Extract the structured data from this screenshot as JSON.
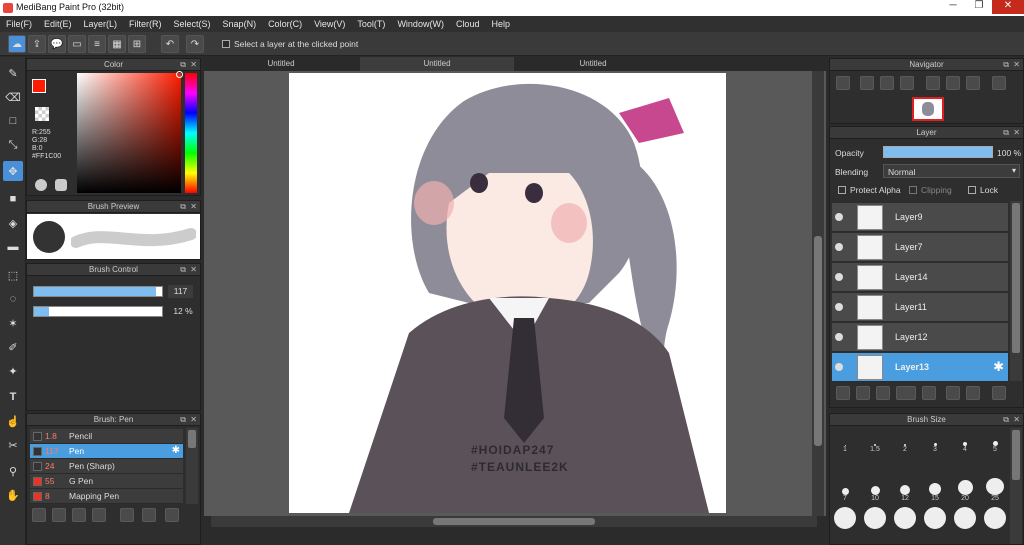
{
  "app": {
    "title": "MediBang Paint Pro (32bit)"
  },
  "menu": [
    "File(F)",
    "Edit(E)",
    "Layer(L)",
    "Filter(R)",
    "Select(S)",
    "Snap(N)",
    "Color(C)",
    "View(V)",
    "Tool(T)",
    "Window(W)",
    "Cloud",
    "Help"
  ],
  "toolbar": {
    "select_layer_label": "Select a layer at the clicked point"
  },
  "tabs": [
    "Untitled",
    "Untitled",
    "Untitled"
  ],
  "color_panel": {
    "title": "Color",
    "r": "R:255",
    "g": "G:28",
    "b": "B:0",
    "hex": "#FF1C00",
    "primary": "#FF1C00"
  },
  "brush_preview": {
    "title": "Brush Preview"
  },
  "brush_control": {
    "title": "Brush Control",
    "size": "117",
    "opacity": "12 %",
    "size_fill": 0.95,
    "opacity_fill": 0.12
  },
  "brush_panel": {
    "title": "Brush: Pen",
    "items": [
      {
        "size": "1.8",
        "name": "Pencil",
        "color": "#333333"
      },
      {
        "size": "117",
        "name": "Pen",
        "color": "#333333",
        "selected": true
      },
      {
        "size": "24",
        "name": "Pen (Sharp)",
        "color": "#333333"
      },
      {
        "size": "55",
        "name": "G Pen",
        "color": "#ee3322"
      },
      {
        "size": "8",
        "name": "Mapping Pen",
        "color": "#ee3322"
      }
    ]
  },
  "navigator": {
    "title": "Navigator"
  },
  "layer_panel": {
    "title": "Layer",
    "opacity_label": "Opacity",
    "opacity_value": "100 %",
    "blending_label": "Blending",
    "blending_value": "Normal",
    "protect_alpha": "Protect Alpha",
    "clipping": "Clipping",
    "lock": "Lock",
    "layers": [
      "Layer9",
      "Layer7",
      "Layer14",
      "Layer11",
      "Layer12",
      "Layer13"
    ]
  },
  "brush_size_panel": {
    "title": "Brush Size",
    "sizes": [
      "1",
      "1.5",
      "2",
      "3",
      "4",
      "5",
      "7",
      "10",
      "12",
      "15",
      "20",
      "25"
    ]
  },
  "artwork": {
    "watermark1": "#HOIDAP247",
    "watermark2": "#TEAUNLEE2K"
  }
}
